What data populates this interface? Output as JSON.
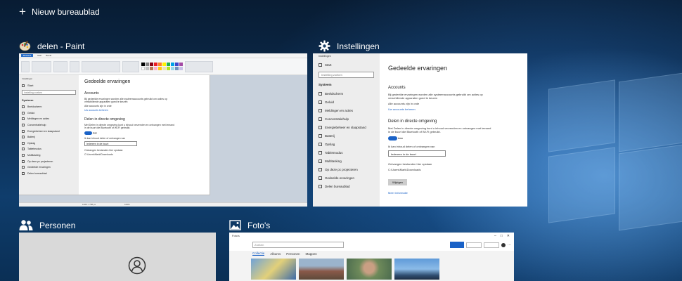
{
  "desktop": {
    "new_desktop_label": "Nieuw bureaublad",
    "background_color": "#0f3d6c"
  },
  "windows": {
    "paint": {
      "title": "delen - Paint",
      "icon": "paint-palette-icon",
      "ribbon_tabs": [
        "Bestand",
        "Start",
        "Beeld"
      ],
      "status_left": "1360 × 768 px",
      "status_zoom": "100%"
    },
    "settings": {
      "title": "Instellingen",
      "icon": "gear-icon",
      "window_label": "Instellingen",
      "start": "Start",
      "search_placeholder": "Instelling zoeken",
      "section": "Systeem",
      "nav": [
        "Beeldscherm",
        "Geluid",
        "Meldingen en acties",
        "Concentratiehulp",
        "Energiebeheer en slaapstand",
        "Batterij",
        "Opslag",
        "Tabletmodus",
        "Multitasking",
        "Op deze pc projecteren",
        "Gedeelde ervaringen",
        "Delen bureaublad"
      ],
      "page_title": "Gedeelde ervaringen",
      "accounts_heading": "Accounts",
      "accounts_text": "Bij gedeelde ervaringen worden alle systeemaccounts gebruikt om acties op verschillende apparaten goed te keuren",
      "accounts_status": "Alle accounts zijn in orde",
      "accounts_link": "Uw accounts beheren",
      "nearby_heading": "Delen in directe omgeving",
      "nearby_text": "Met Delen in directe omgeving kunt u inhoud verzenden en ontvangen met iemand in de buurt die Bluetooth of Wi-Fi gebruikt.",
      "toggle_label": "Aan",
      "receive_label": "Ik kan inhoud delen of ontvangen van",
      "receive_value": "Iedereen in de buurt",
      "save_label": "Ontvangen bestanden hier opslaan",
      "save_path": "C:\\Users\\Mark\\Downloads",
      "change_button": "Wijzigen",
      "more_link": "Meer informatie"
    },
    "personen": {
      "title": "Personen",
      "icon": "people-icon"
    },
    "fotos": {
      "title": "Foto's",
      "icon": "photo-icon",
      "app_name": "Foto's",
      "search_placeholder": "Zoeken",
      "tabs": [
        "Collectie",
        "Albums",
        "Personen",
        "Mappen"
      ]
    }
  }
}
